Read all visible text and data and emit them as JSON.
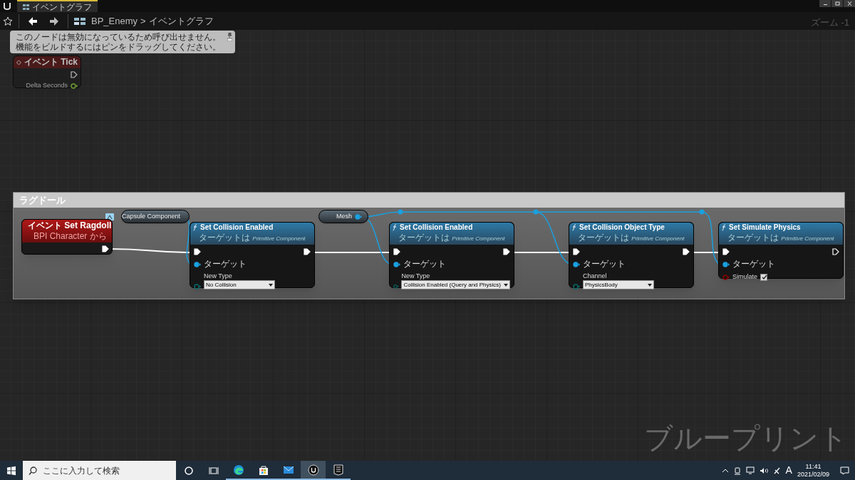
{
  "title_bar": {
    "tabs": [
      {
        "label": "イベントグラフ",
        "selected": true
      }
    ]
  },
  "toolbar": {
    "blueprint": "BP_Enemy",
    "separator": ">",
    "graph": "イベントグラフ",
    "zoom": "ズーム -1"
  },
  "graph": {
    "tooltip": {
      "lines": [
        "このノードは無効になっているため呼び出せません。",
        "機能をビルドするにはピンをドラッグしてください。"
      ]
    },
    "comment": {
      "title": "ラグドール"
    },
    "nodes": [
      {
        "kind": "event",
        "title": "イベント Tick",
        "disabled": true,
        "exec_connected": false,
        "output": "Delta Seconds"
      },
      {
        "kind": "event",
        "title": "イベント Set Ragdoll",
        "subtitle": "BPI Character から",
        "disabled": false,
        "exec_connected": true
      },
      {
        "kind": "variable",
        "title": "Capsule Component"
      },
      {
        "kind": "function",
        "title": "Set Collision Enabled",
        "subtitle": "ターゲットは *Primitive Component*",
        "target": "ターゲット",
        "exec_connected": true,
        "param": {
          "kind": "enum",
          "label": "New Type",
          "value": "No Collision"
        }
      },
      {
        "kind": "variable",
        "title": "Mesh"
      },
      {
        "kind": "function",
        "title": "Set Collision Enabled",
        "subtitle": "ターゲットは *Primitive Component*",
        "target": "ターゲット",
        "exec_connected": true,
        "param": {
          "kind": "enum",
          "label": "New Type",
          "value": "Collision Enabled (Query and Physics)"
        }
      },
      {
        "kind": "function",
        "title": "Set Collision Object Type",
        "subtitle": "ターゲットは *Primitive Component*",
        "target": "ターゲット",
        "exec_connected": true,
        "param": {
          "kind": "enum",
          "label": "Channel",
          "value": "PhysicsBody"
        }
      },
      {
        "kind": "function",
        "title": "Set Simulate Physics",
        "subtitle": "ターゲットは *Primitive Component*",
        "target": "ターゲット",
        "exec_connected": false,
        "param": {
          "kind": "bool",
          "label": "Simulate",
          "checked": true
        }
      }
    ],
    "graph_label": "ブループリント"
  },
  "taskbar": {
    "search_placeholder": "ここに入力して検索",
    "ime": "A",
    "time": "11:41",
    "date": "2021/02/09"
  }
}
